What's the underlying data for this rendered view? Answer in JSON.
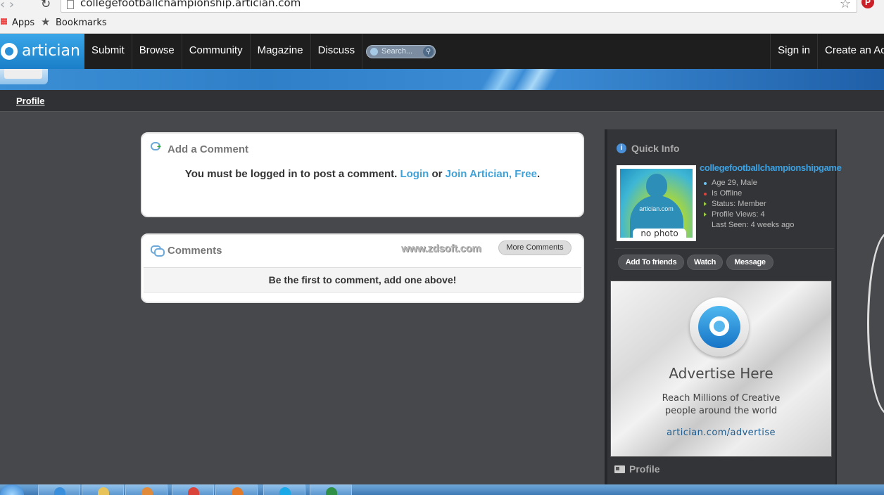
{
  "browser": {
    "url": "collegefootballchampionship.artician.com",
    "bookmarks_bar": {
      "apps": "Apps",
      "bookmarks": "Bookmarks"
    }
  },
  "site": {
    "logo_text": "artician",
    "nav": [
      "Submit",
      "Browse",
      "Community",
      "Magazine",
      "Discuss"
    ],
    "search_placeholder": "Search...",
    "sign_in": "Sign in",
    "create_account": "Create an Ac",
    "subnav_profile": "Profile"
  },
  "add_comment": {
    "title": "Add a Comment",
    "message": "You must be logged in to post a comment.",
    "login": "Login",
    "or": "or",
    "join": "Join Artician, Free",
    "period": "."
  },
  "comments": {
    "title": "Comments",
    "watermark": "www.zdsoft.com",
    "more_button": "More Comments",
    "empty_message": "Be the first to comment, add one above!"
  },
  "quick_info": {
    "title": "Quick Info",
    "photo_brand": "artician.com",
    "no_photo": "no photo",
    "username": "collegefootballchampionshipgame",
    "details": [
      {
        "text": "Age 29, Male",
        "bullet_color": "#6cc3f5"
      },
      {
        "text": "Is Offline",
        "bullet_color": "#e0413b"
      },
      {
        "text": "Status: Member",
        "bullet_color": "#99cc44"
      },
      {
        "text": "Profile Views: 4",
        "bullet_color": "#99cc44"
      },
      {
        "text": "Last Seen: 4 weeks ago",
        "bullet_color": ""
      }
    ],
    "actions": [
      "Add To friends",
      "Watch",
      "Message"
    ]
  },
  "advert": {
    "title": "Advertise Here",
    "line1": "Reach Millions of Creative",
    "line2": "people around the world",
    "url": "artician.com/advertise"
  },
  "profile_section": {
    "title": "Profile"
  }
}
